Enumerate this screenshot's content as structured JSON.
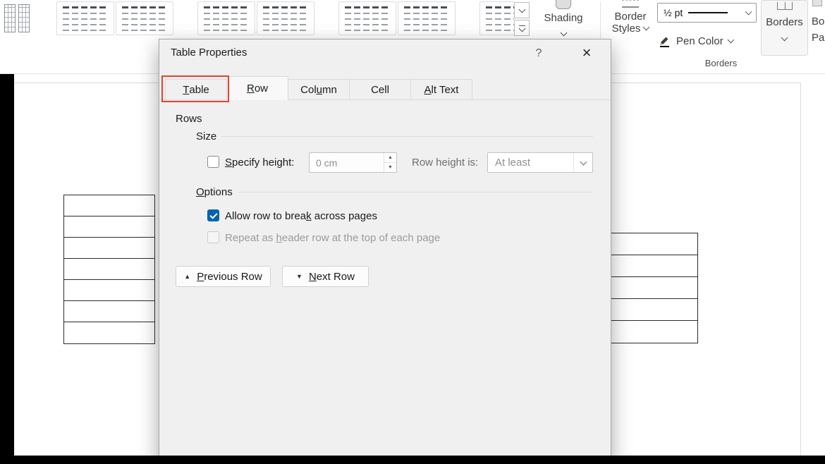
{
  "colors": {
    "accent": "#0062b1",
    "highlight_red": "#e8402d"
  },
  "ribbon": {
    "gallery": {
      "items": [
        "grid",
        "dashed",
        "dashed",
        "dashed",
        "dashed",
        "dashed",
        "dashed",
        "dashed"
      ]
    },
    "shading": {
      "label": "Shading",
      "icon": "paint-bucket"
    },
    "border_styles": {
      "line1": "Border",
      "line2": "Styles",
      "icon": "border-style-sample"
    },
    "line_weight": {
      "value": "½ pt",
      "icon": "line-weight-sample"
    },
    "pen_color": {
      "label": "Pen Color",
      "icon": "pencil"
    },
    "borders_button": {
      "label": "Borders",
      "icon": "borders-grid"
    },
    "border_painter": {
      "line1": "Bo",
      "line2": "Pa"
    },
    "group_label": "Borders"
  },
  "dialog": {
    "title": "Table Properties",
    "help_label": "?",
    "close_label": "×",
    "tabs": [
      {
        "label_html": "<u>T</u>able",
        "highlighted": true
      },
      {
        "label_html": "<u>R</u>ow",
        "selected": true
      },
      {
        "label_html": "Col<u>u</u>mn"
      },
      {
        "label_html": "Cell"
      },
      {
        "label_html": "<u>A</u>lt Text"
      }
    ],
    "rows_label": "Rows",
    "size_group_label": "Size",
    "specify_height_html": "<u>S</u>pecify height:",
    "specify_height_checked": false,
    "height_value": "0 cm",
    "row_height_is_label": "Row height is:",
    "row_height_mode": "At least",
    "options_group_html": "<u>O</u>ptions",
    "allow_break_html": "Allow row to brea<u>k</u> across pages",
    "allow_break_checked": true,
    "repeat_header_html": "Repeat as <u>h</u>eader row at the top of each page",
    "repeat_header_enabled": false,
    "previous_row_html": "<u>P</u>revious Row",
    "next_row_html": "<u>N</u>ext Row"
  },
  "document": {
    "left_table_rows": 7,
    "right_table_rows": 5
  }
}
